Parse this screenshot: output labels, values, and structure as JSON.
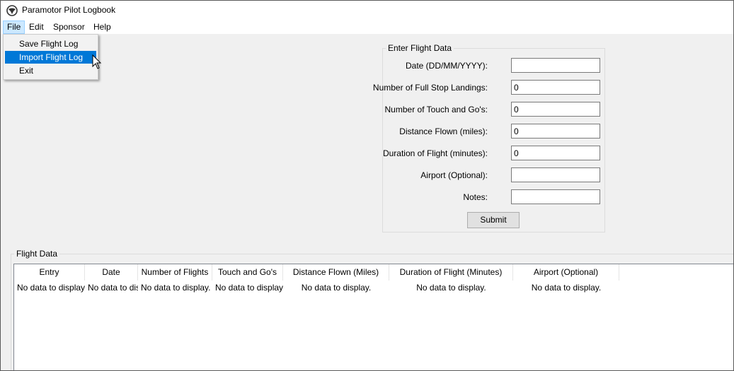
{
  "window": {
    "title": "Paramotor Pilot Logbook"
  },
  "menubar": {
    "items": [
      "File",
      "Edit",
      "Sponsor",
      "Help"
    ]
  },
  "file_menu": {
    "items": [
      "Save Flight Log",
      "Import Flight Log",
      "Exit"
    ],
    "highlighted": "Import Flight Log"
  },
  "entry_form": {
    "legend": "Enter Flight Data",
    "fields": [
      {
        "label": "Date (DD/MM/YYYY):",
        "value": ""
      },
      {
        "label": "Number of Full Stop Landings:",
        "value": "0"
      },
      {
        "label": "Number of Touch and Go's:",
        "value": "0"
      },
      {
        "label": "Distance Flown (miles):",
        "value": "0"
      },
      {
        "label": "Duration of Flight (minutes):",
        "value": "0"
      },
      {
        "label": "Airport (Optional):",
        "value": ""
      },
      {
        "label": "Notes:",
        "value": ""
      }
    ],
    "submit_label": "Submit"
  },
  "flight_data": {
    "legend": "Flight Data",
    "columns": [
      "Entry",
      "Date",
      "Number of Flights",
      "Touch and Go's",
      "Distance Flown (Miles)",
      "Duration of Flight (Minutes)",
      "Airport (Optional)"
    ],
    "rows": [
      [
        "No data to display.",
        "No data to display.",
        "No data to display.",
        "No data to display.",
        "No data to display.",
        "No data to display.",
        "No data to display."
      ]
    ]
  },
  "colors": {
    "menu_highlight": "#0078d7",
    "active_menu_bg": "#cce8ff",
    "window_bg": "#f0f0f0"
  }
}
